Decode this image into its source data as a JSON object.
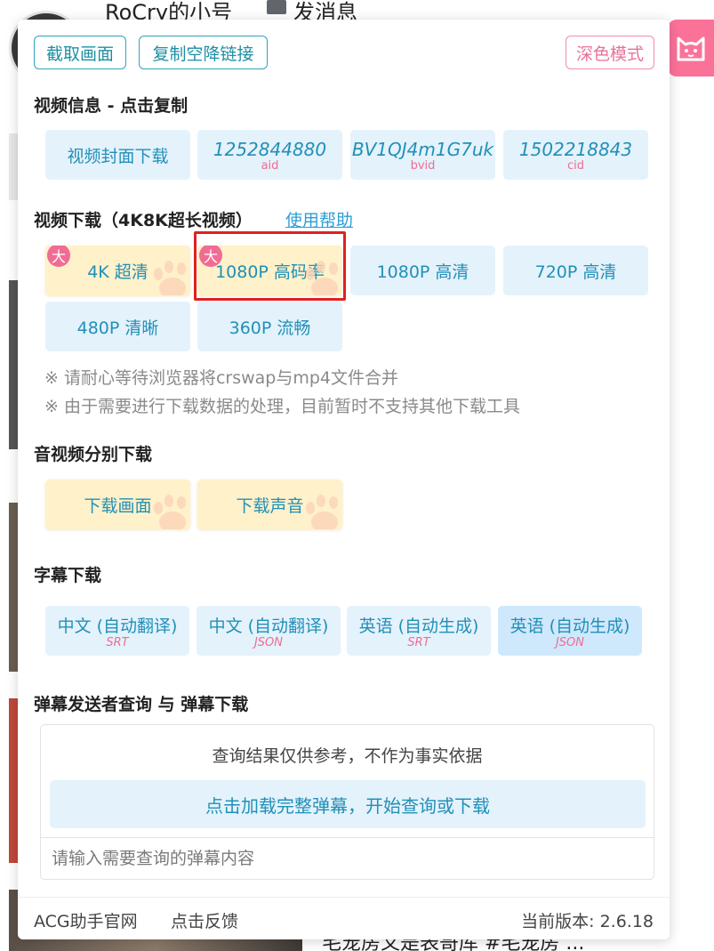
{
  "background": {
    "username": "RoCry的小号",
    "message_label": "发消息",
    "footer_text": "毛宠房又是表哥库 #毛宠房 ..."
  },
  "toolbar": {
    "capture_label": "截取画面",
    "copy_link_label": "复制空降链接",
    "dark_mode_label": "深色模式"
  },
  "video_info": {
    "title": "视频信息 - 点击复制",
    "cover_label": "视频封面下载",
    "items": [
      {
        "value": "1252844880",
        "caption": "aid"
      },
      {
        "value": "BV1QJ4m1G7uk",
        "caption": "bvid"
      },
      {
        "value": "1502218843",
        "caption": "cid"
      }
    ]
  },
  "video_download": {
    "title": "视频下载（4K8K超长视频）",
    "help_label": "使用帮助",
    "big_badge": "大",
    "qualities": [
      {
        "label": "4K 超清",
        "big": true,
        "style": "yellow"
      },
      {
        "label": "1080P 高码率",
        "big": true,
        "style": "yellow"
      },
      {
        "label": "1080P 高清",
        "big": false,
        "style": "blue"
      },
      {
        "label": "720P 高清",
        "big": false,
        "style": "blue"
      },
      {
        "label": "480P 清晰",
        "big": false,
        "style": "blue"
      },
      {
        "label": "360P 流畅",
        "big": false,
        "style": "blue"
      }
    ],
    "notes": [
      "※ 请耐心等待浏览器将crswap与mp4文件合并",
      "※ 由于需要进行下载数据的处理，目前暂时不支持其他下载工具"
    ]
  },
  "separate_download": {
    "title": "音视频分别下载",
    "video_label": "下载画面",
    "audio_label": "下载声音"
  },
  "subtitle_download": {
    "title": "字幕下载",
    "items": [
      {
        "label": "中文 (自动翻译)",
        "format": "SRT"
      },
      {
        "label": "中文 (自动翻译)",
        "format": "JSON"
      },
      {
        "label": "英语 (自动生成)",
        "format": "SRT"
      },
      {
        "label": "英语 (自动生成)",
        "format": "JSON"
      }
    ]
  },
  "danmaku": {
    "title": "弹幕发送者查询 与 弹幕下载",
    "disclaimer": "查询结果仅供参考，不作为事实依据",
    "load_label": "点击加载完整弹幕，开始查询或下载",
    "input_placeholder": "请输入需要查询的弹幕内容"
  },
  "footer": {
    "site_label": "ACG助手官网",
    "feedback_label": "点击反馈",
    "version_text": "当前版本: 2.6.18"
  },
  "colors": {
    "accent": "#2190b8",
    "pink": "#f06c94",
    "tile_blue": "#e4f2fb",
    "tile_yellow": "#fff1c9",
    "highlight": "#e02020"
  }
}
